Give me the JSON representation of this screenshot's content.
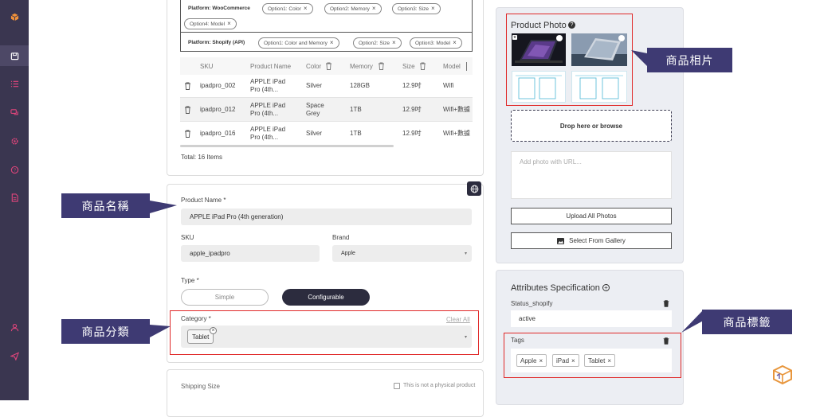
{
  "variants": {
    "woo_label": "Platform: WooCommerce",
    "woo_chips": [
      "Option1: Color",
      "Option2: Memory",
      "Option3: Size",
      "Option4: Model"
    ],
    "shopify_label": "Platform: Shopify (API)",
    "shopify_chips": [
      "Option1: Color and Memory",
      "Option2: Size",
      "Option3: Model"
    ],
    "columns": [
      "SKU",
      "Product Name",
      "Color",
      "Memory",
      "Size",
      "Model"
    ],
    "rows": [
      {
        "sku": "ipadpro_002",
        "name1": "APPLE iPad",
        "name2": "Pro (4th...",
        "color1": "Silver",
        "color2": "",
        "memory": "128GB",
        "size": "12.9吋",
        "model": "Wifi"
      },
      {
        "sku": "ipadpro_012",
        "name1": "APPLE iPad",
        "name2": "Pro (4th...",
        "color1": "Space",
        "color2": "Grey",
        "memory": "1TB",
        "size": "12.9吋",
        "model": "Wifi+數據"
      },
      {
        "sku": "ipadpro_016",
        "name1": "APPLE iPad",
        "name2": "Pro (4th...",
        "color1": "Silver",
        "color2": "",
        "memory": "1TB",
        "size": "12.9吋",
        "model": "Wifi+數據"
      }
    ],
    "total": "Total: 16 Items"
  },
  "product": {
    "name_label": "Product Name *",
    "name_value": "APPLE iPad Pro (4th generation)",
    "sku_label": "SKU",
    "sku_value": "apple_ipadpro",
    "brand_label": "Brand",
    "brand_value": "Apple",
    "type_label": "Type *",
    "type_simple": "Simple",
    "type_configurable": "Configurable",
    "category_label": "Category *",
    "clear_all": "Clear All",
    "category_tag": "Tablet",
    "shipping_label": "Shipping Size",
    "not_physical": "This is not a physical product"
  },
  "photos": {
    "title": "Product Photo",
    "drop": "Drop here or browse",
    "url_placeholder": "Add photo with URL...",
    "upload_all": "Upload All Photos",
    "select_gallery": "Select From Gallery"
  },
  "attributes": {
    "title": "Attributes Specification",
    "status_label": "Status_shopify",
    "status_value": "active",
    "tags_label": "Tags",
    "tags": [
      "Apple",
      "iPad",
      "Tablet"
    ]
  },
  "callouts": {
    "photo": "商品相片",
    "name": "商品名稱",
    "category": "商品分類",
    "tags": "商品標籤"
  },
  "colors": {
    "sidebar": "#3a3650",
    "callout": "#3e3a73",
    "highlight": "#e02828",
    "accent_dark": "#2c2c3e"
  }
}
